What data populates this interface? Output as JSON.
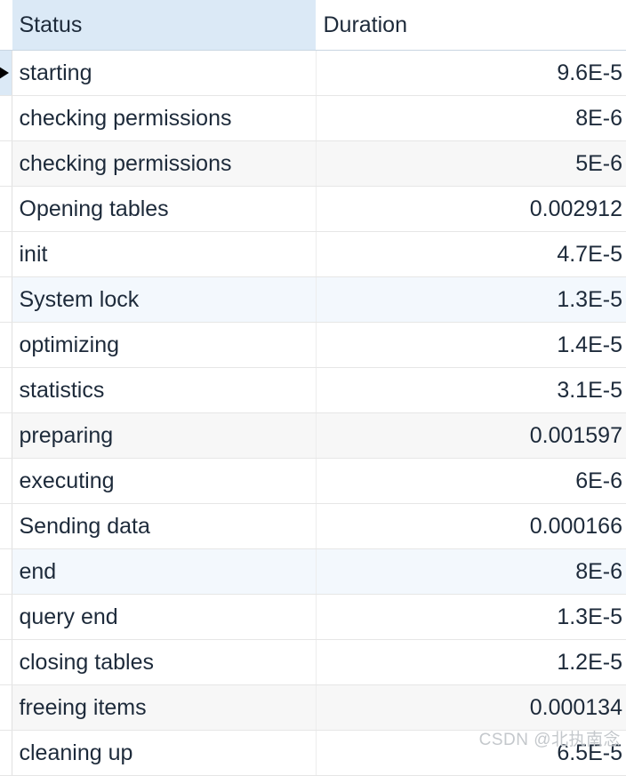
{
  "table": {
    "columns": [
      {
        "key": "status",
        "label": "Status",
        "align": "left",
        "header_bg": "#dbe9f6"
      },
      {
        "key": "duration",
        "label": "Duration",
        "align": "right",
        "header_bg": "#ffffff"
      }
    ],
    "current_row_index": 0,
    "row_marker_glyph": "▶",
    "colors": {
      "header_selected_bg": "#dbe9f6",
      "row_white": "#ffffff",
      "row_gray": "#f7f7f7",
      "row_blue_tint": "#f3f8fd",
      "text": "#1d2a3a",
      "grid_line": "#e6e6e6",
      "watermark": "#c4c8cc"
    },
    "rows": [
      {
        "status": "starting",
        "duration": "9.6E-5",
        "bg": "white"
      },
      {
        "status": "checking permissions",
        "duration": "8E-6",
        "bg": "white"
      },
      {
        "status": "checking permissions",
        "duration": "5E-6",
        "bg": "gray"
      },
      {
        "status": "Opening tables",
        "duration": "0.002912",
        "bg": "white"
      },
      {
        "status": "init",
        "duration": "4.7E-5",
        "bg": "white"
      },
      {
        "status": "System lock",
        "duration": "1.3E-5",
        "bg": "blue"
      },
      {
        "status": "optimizing",
        "duration": "1.4E-5",
        "bg": "white"
      },
      {
        "status": "statistics",
        "duration": "3.1E-5",
        "bg": "white"
      },
      {
        "status": "preparing",
        "duration": "0.001597",
        "bg": "gray"
      },
      {
        "status": "executing",
        "duration": "6E-6",
        "bg": "white"
      },
      {
        "status": "Sending data",
        "duration": "0.000166",
        "bg": "white"
      },
      {
        "status": "end",
        "duration": "8E-6",
        "bg": "blue"
      },
      {
        "status": "query end",
        "duration": "1.3E-5",
        "bg": "white"
      },
      {
        "status": "closing tables",
        "duration": "1.2E-5",
        "bg": "white"
      },
      {
        "status": "freeing items",
        "duration": "0.000134",
        "bg": "gray"
      },
      {
        "status": "cleaning up",
        "duration": "6.5E-5",
        "bg": "white"
      }
    ]
  },
  "watermark": {
    "text": "CSDN @北执南念"
  }
}
